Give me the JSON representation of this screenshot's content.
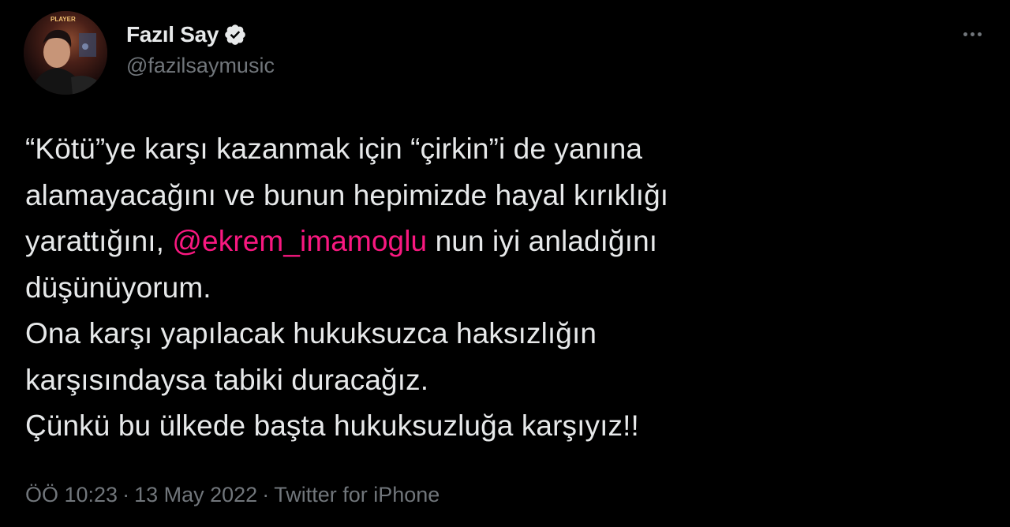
{
  "author": {
    "display_name": "Fazıl Say",
    "handle": "@fazilsaymusic",
    "verified_icon": "verified-badge-icon",
    "avatar": "profile-photo",
    "avatar_sign_text": "PLAYER"
  },
  "more_menu": {
    "icon": "more-horizontal-icon"
  },
  "tweet": {
    "lines": [
      {
        "text": "“Kötü”ye karşı kazanmak için “çirkin”i de yanına"
      },
      {
        "text": "alamayacağını ve bunun hepimizde hayal kırıklığı"
      },
      {
        "before": "yarattığını, ",
        "mention": "@ekrem_imamoglu",
        "after": " nun iyi anladığını"
      },
      {
        "text": "düşünüyorum."
      },
      {
        "text": "Ona karşı yapılacak hukuksuzca haksızlığın"
      },
      {
        "text": "karşısındaysa tabiki duracağız."
      },
      {
        "text": "Çünkü bu ülkede başta hukuksuzluğa karşıyız!!"
      }
    ]
  },
  "meta": {
    "time": "ÖÖ 10:23",
    "separator": "·",
    "date": "13 May 2022",
    "source": "Twitter for iPhone"
  },
  "colors": {
    "background": "#000000",
    "text": "#e7e9ea",
    "secondary": "#71767b",
    "mention": "#f91880"
  }
}
